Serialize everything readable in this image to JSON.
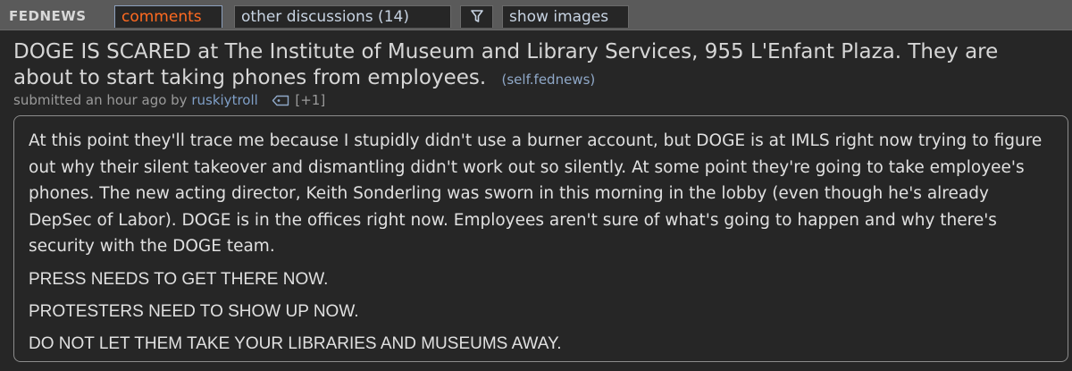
{
  "topbar": {
    "subreddit": "FEDNEWS",
    "tabs": {
      "comments": "comments",
      "other_discussions": "other discussions (14)",
      "filter_icon": "filter-funnel-icon",
      "show_images": "show images"
    },
    "colors": {
      "bar": "#5a5a5a",
      "selected_tab_text": "#ff6a20",
      "tab_text": "#c8d4e3"
    }
  },
  "post": {
    "title": "DOGE IS SCARED at The Institute of Museum and Library Services, 955 L'Enfant Plaza. They are about to start taking phones from employees.",
    "domain": "(self.fednews)",
    "tagline_prefix": "submitted an hour ago by",
    "author": "ruskiytroll",
    "tag_icon": "tag-icon",
    "author_flair": "[+1]",
    "paragraphs": [
      "At this point they'll trace me because I stupidly didn't use a burner account, but DOGE is at IMLS right now trying to figure out why their silent takeover and dismantling didn't work out so silently. At some point they're going to take employee's phones. The new acting director, Keith Sonderling was sworn in this morning in the lobby (even though he's already DepSec of Labor). DOGE is in the offices right now. Employees aren't sure of what's going to happen and why there's security with the DOGE team.",
      "PRESS NEEDS TO GET THERE NOW.",
      "PROTESTERS NEED TO SHOW UP NOW.",
      "DO NOT LET THEM TAKE YOUR LIBRARIES AND MUSEUMS AWAY."
    ]
  }
}
